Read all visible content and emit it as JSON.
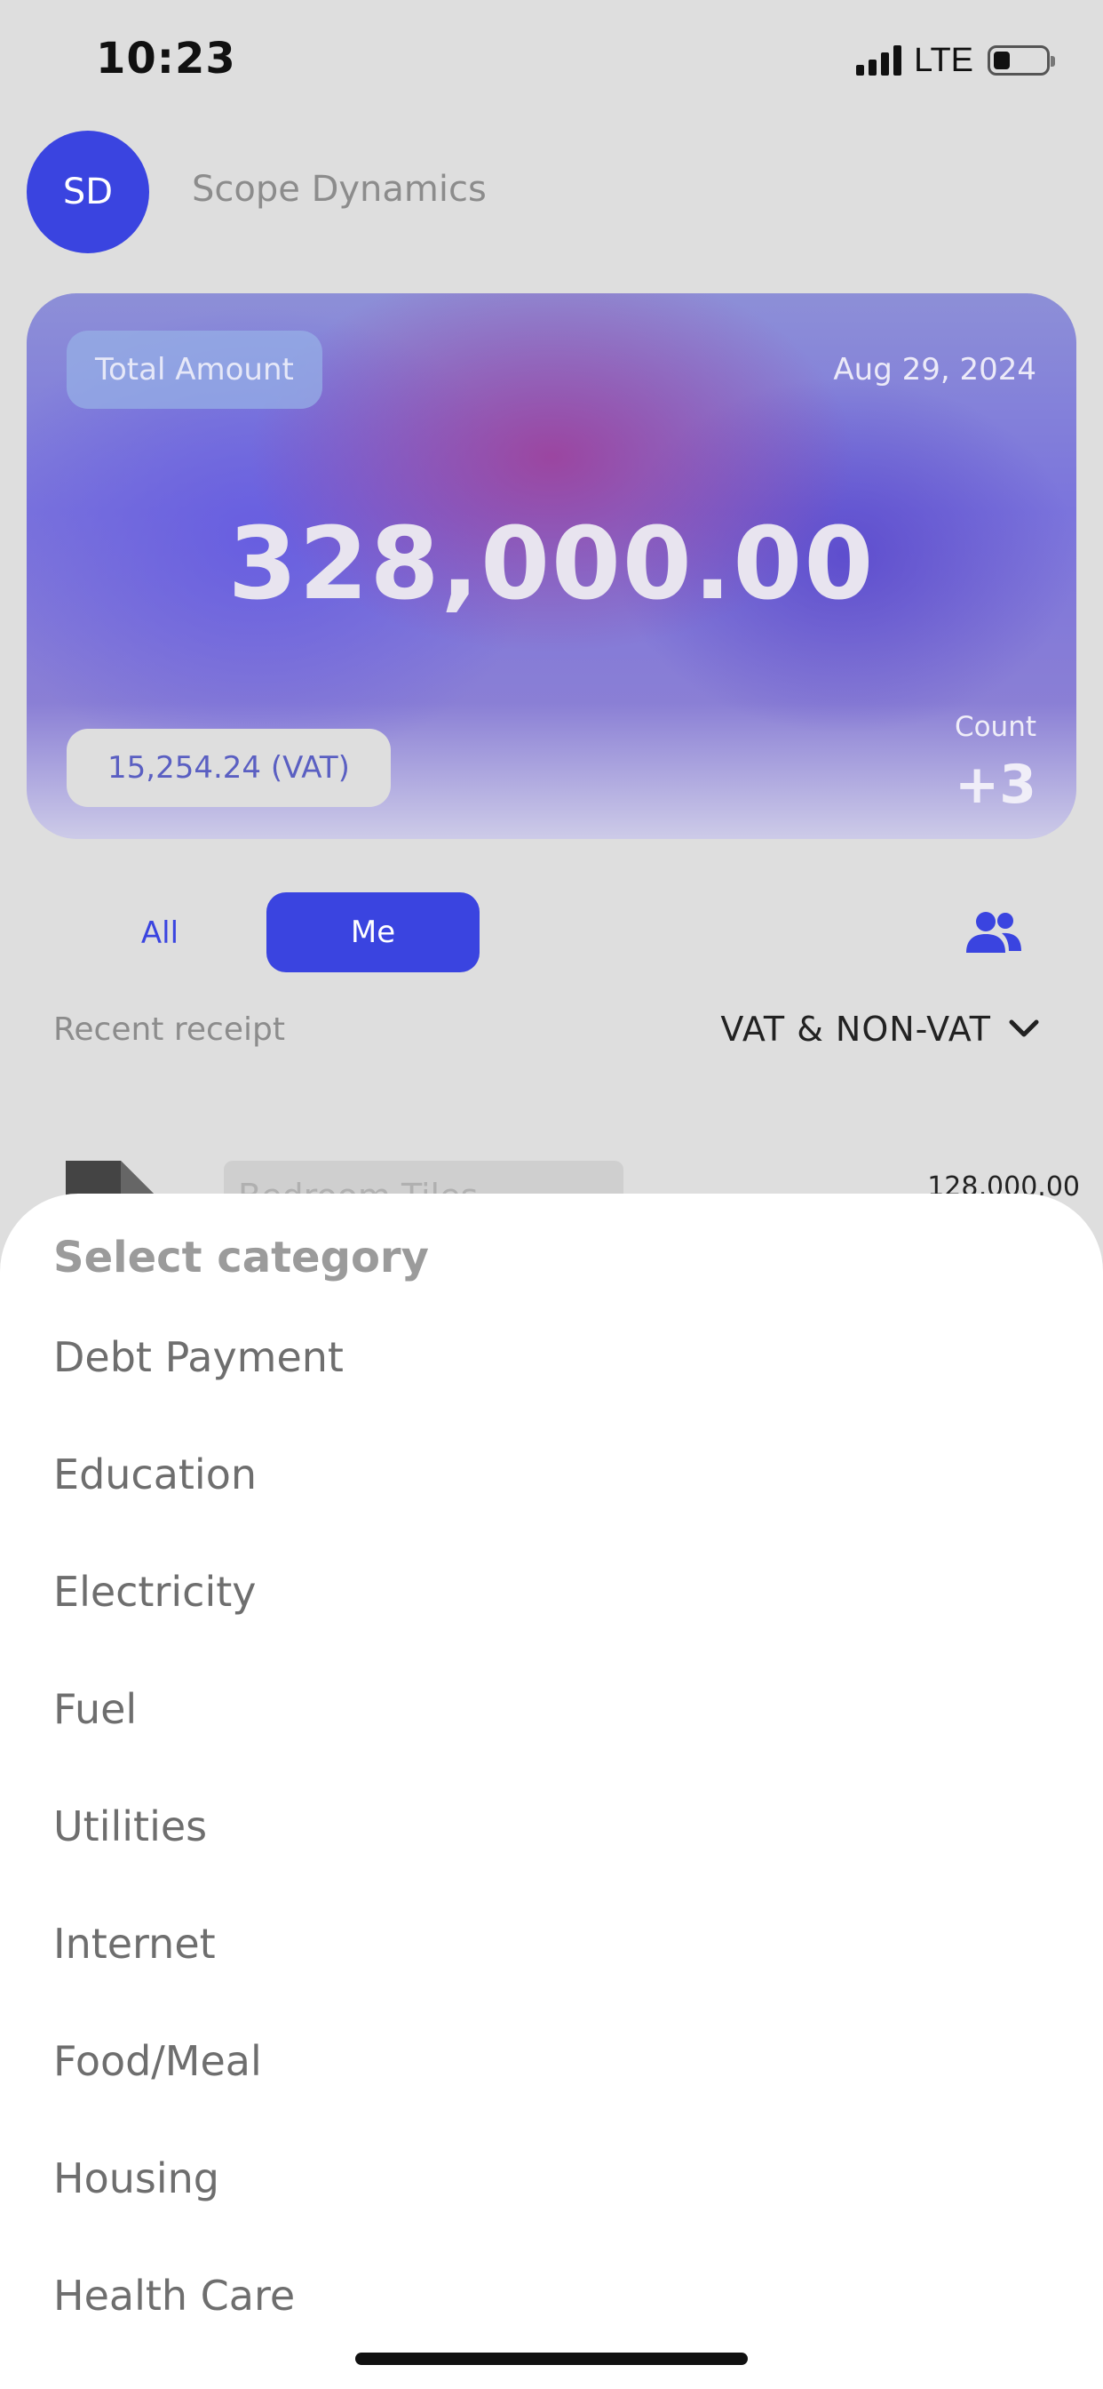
{
  "status": {
    "time": "10:23",
    "network": "LTE"
  },
  "header": {
    "avatar_initials": "SD",
    "company": "Scope Dynamics"
  },
  "card": {
    "label": "Total Amount",
    "date": "Aug 29, 2024",
    "amount": "328,000.00",
    "vat": "15,254.24 (VAT)",
    "count_label": "Count",
    "count": "+3"
  },
  "tabs": {
    "all": "All",
    "me": "Me",
    "selected": "Me"
  },
  "recent": {
    "label": "Recent receipt",
    "filter": "VAT & NON-VAT"
  },
  "receipt": {
    "title": "Bedroom Tiles",
    "amount": "128,000.00"
  },
  "sheet": {
    "title": "Select category",
    "items": [
      "Debt Payment",
      "Education",
      "Electricity",
      "Fuel",
      "Utilities",
      "Internet",
      "Food/Meal",
      "Housing",
      "Health Care"
    ]
  },
  "colors": {
    "accent": "#3a44e0",
    "background": "#dedede"
  }
}
